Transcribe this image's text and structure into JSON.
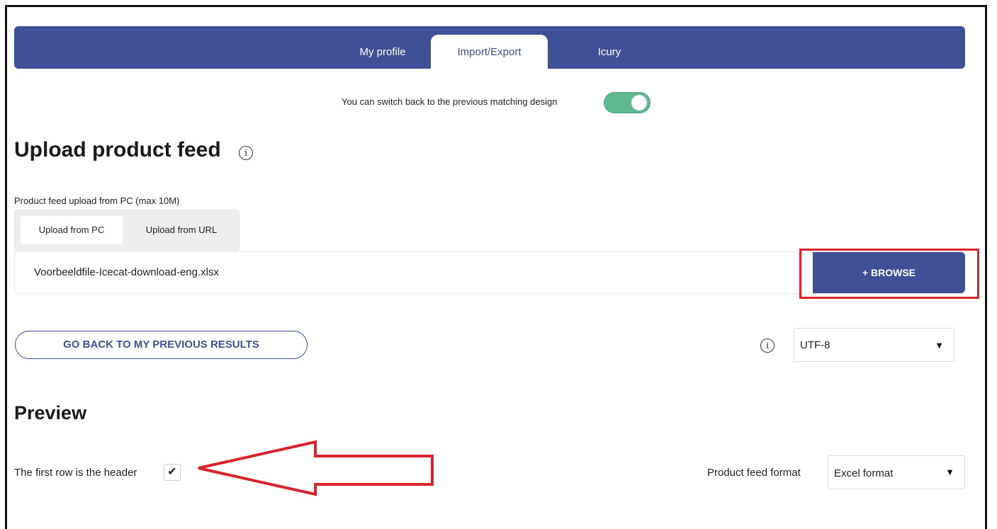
{
  "nav": {
    "tabs": [
      {
        "label": "My profile"
      },
      {
        "label": "Import/Export"
      },
      {
        "label": "Icury"
      }
    ],
    "active_tab": "Import/Export"
  },
  "design_toggle": {
    "text": "You can switch back to the previous matching design",
    "enabled": true
  },
  "upload": {
    "title": "Upload product feed",
    "info_icon": "i",
    "source_label": "Product feed upload from PC (max 10M)",
    "source_tabs": [
      {
        "label": "Upload from PC"
      },
      {
        "label": "Upload from URL"
      }
    ],
    "file_name": "Voorbeeldfile-Icecat-download-eng.xlsx",
    "browse_label": "+ BROWSE",
    "go_back_label": "GO BACK TO MY PREVIOUS RESULTS",
    "encoding_info_icon": "i",
    "encoding_value": "UTF-8"
  },
  "preview": {
    "title": "Preview",
    "header_row_label": "The first row is the header",
    "header_row_checked": true,
    "check_glyph": "✔",
    "format_label": "Product feed format",
    "format_value": "Excel format",
    "dropdown_glyph": "▼"
  },
  "colors": {
    "primary": "#3f5096",
    "toggle_on": "#5fb88f",
    "annotation_red": "#d9232d"
  }
}
